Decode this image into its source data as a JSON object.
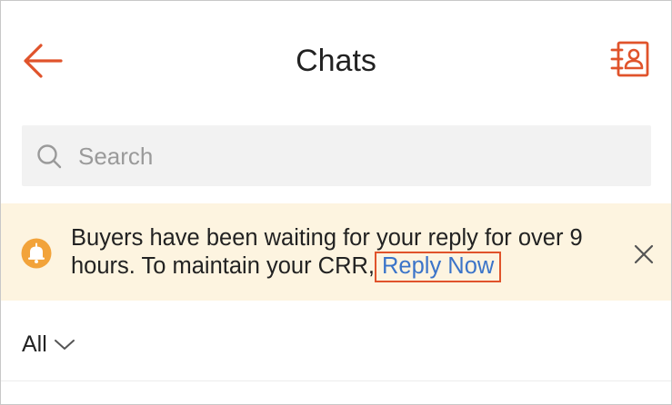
{
  "header": {
    "title": "Chats",
    "back_icon": "arrow-left-icon",
    "contacts_icon": "contact-book-icon"
  },
  "search": {
    "placeholder": "Search",
    "value": "",
    "icon": "search-icon"
  },
  "banner": {
    "icon": "bell-icon",
    "message": "Buyers have been waiting for your reply for over 9 hours. To maintain your CRR,",
    "action_label": "Reply Now",
    "close_icon": "close-icon"
  },
  "filter": {
    "selected": "All",
    "icon": "chevron-down-icon"
  },
  "colors": {
    "accent": "#e0532b",
    "link": "#3b74c9",
    "banner_bg": "#fdf4e0",
    "search_bg": "#f2f2f2"
  }
}
